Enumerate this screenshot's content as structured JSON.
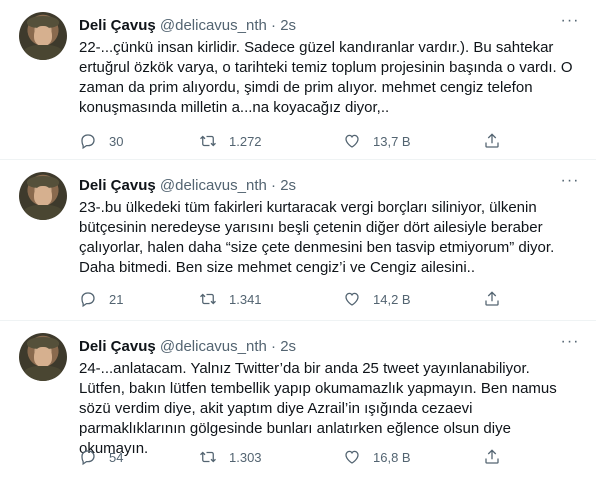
{
  "tweets": [
    {
      "name": "Deli Çavuş",
      "handle": "@delicavus_nth",
      "time": "2s",
      "text": "22-...çünkü insan kirlidir. Sadece güzel kandıranlar vardır.). Bu sahtekar ertuğrul özkök varya, o tarihteki temiz toplum projesinin başında o vardı. O zaman da prim alıyordu, şimdi de prim alıyor. mehmet cengiz telefon konuşmasında milletin a...na koyacağız diyor,..",
      "replies": "30",
      "retweets": "1.272",
      "likes": "13,7 B"
    },
    {
      "name": "Deli Çavuş",
      "handle": "@delicavus_nth",
      "time": "2s",
      "text": "23-.bu ülkedeki tüm fakirleri kurtaracak vergi borçları siliniyor, ülkenin bütçesinin neredeyse yarısını beşli çetenin diğer dört ailesiyle beraber çalıyorlar, halen daha “size çete denmesini ben tasvip etmiyorum” diyor. Daha bitmedi. Ben size mehmet cengiz’i ve Cengiz ailesini..",
      "replies": "21",
      "retweets": "1.341",
      "likes": "14,2 B"
    },
    {
      "name": "Deli Çavuş",
      "handle": "@delicavus_nth",
      "time": "2s",
      "text": "24-...anlatacam. Yalnız Twitter’da bir anda 25 tweet yayınlanabiliyor. Lütfen, bakın lütfen tembellik yapıp okumamazlık yapmayın. Ben namus sözü verdim diye, akit yaptım diye Azrail’in ışığında cezaevi parmaklıklarının gölgesinde bunları anlatırken eğlence olsun diye okumayın.",
      "replies": "54",
      "retweets": "1.303",
      "likes": "16,8 B"
    }
  ],
  "icons": {
    "reply": "reply-icon",
    "retweet": "retweet-icon",
    "like": "heart-icon",
    "share": "share-icon",
    "more": "more-icon"
  },
  "separator": "·",
  "more_glyph": "···"
}
